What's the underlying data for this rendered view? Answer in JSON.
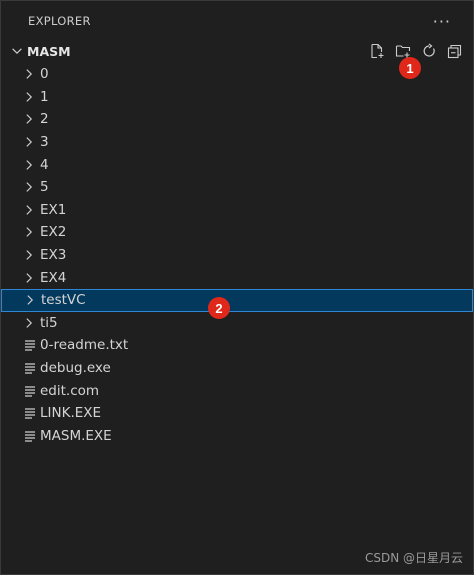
{
  "panel": {
    "title": "EXPLORER",
    "more_label": "···"
  },
  "section": {
    "title": "MASM"
  },
  "actions": [
    {
      "name": "new-file-button",
      "icon": "new-file-icon"
    },
    {
      "name": "new-folder-button",
      "icon": "new-folder-icon"
    },
    {
      "name": "refresh-button",
      "icon": "refresh-icon"
    },
    {
      "name": "collapse-all-button",
      "icon": "collapse-all-icon"
    }
  ],
  "items": [
    {
      "label": "0",
      "type": "folder"
    },
    {
      "label": "1",
      "type": "folder"
    },
    {
      "label": "2",
      "type": "folder"
    },
    {
      "label": "3",
      "type": "folder"
    },
    {
      "label": "4",
      "type": "folder"
    },
    {
      "label": "5",
      "type": "folder"
    },
    {
      "label": "EX1",
      "type": "folder"
    },
    {
      "label": "EX2",
      "type": "folder"
    },
    {
      "label": "EX3",
      "type": "folder"
    },
    {
      "label": "EX4",
      "type": "folder"
    },
    {
      "label": "testVC",
      "type": "folder",
      "selected": true
    },
    {
      "label": "ti5",
      "type": "folder"
    },
    {
      "label": "0-readme.txt",
      "type": "file"
    },
    {
      "label": "debug.exe",
      "type": "file"
    },
    {
      "label": "edit.com",
      "type": "file"
    },
    {
      "label": "LINK.EXE",
      "type": "file"
    },
    {
      "label": "MASM.EXE",
      "type": "file"
    }
  ],
  "annotations": {
    "badge1": "1",
    "badge2": "2"
  },
  "watermark": "CSDN @日星月云",
  "colors": {
    "background": "#1f1f1f",
    "selection": "#04395e",
    "selection_border": "#2f86d4",
    "badge": "#e0281a"
  }
}
